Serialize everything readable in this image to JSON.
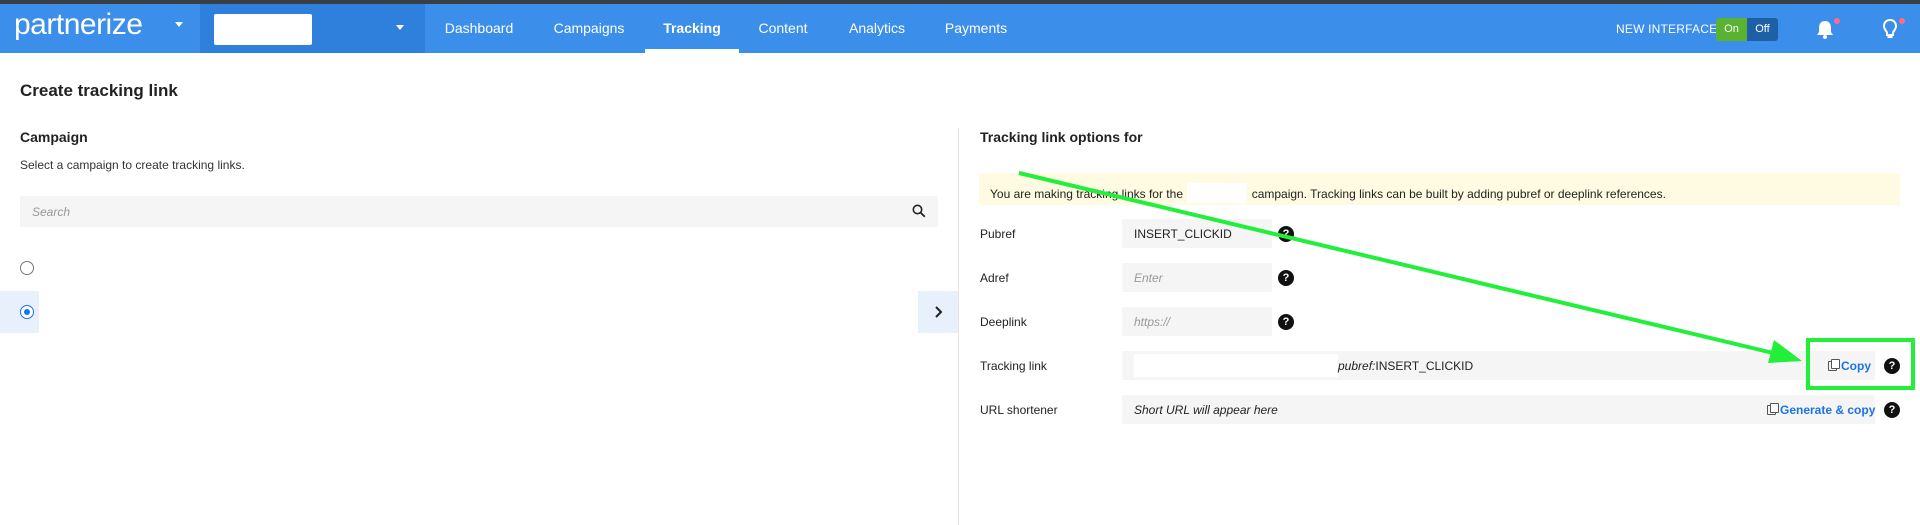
{
  "colors": {
    "nav_bg": "#3b8ee9",
    "accent": "#1a73e8",
    "toggle_on": "#5ab233",
    "annotation": "#22ef3a"
  },
  "navbar": {
    "logo": "partnerize",
    "tabs": [
      {
        "label": "Dashboard"
      },
      {
        "label": "Campaigns"
      },
      {
        "label": "Tracking"
      },
      {
        "label": "Content"
      },
      {
        "label": "Analytics"
      },
      {
        "label": "Payments"
      }
    ],
    "active_tab": "Tracking",
    "new_interface_label": "NEW INTERFACE",
    "toggle_on": "On",
    "toggle_off": "Off",
    "icons": [
      "bell-icon",
      "lightbulb-icon"
    ]
  },
  "page": {
    "title": "Create tracking link"
  },
  "campaign": {
    "title": "Campaign",
    "hint": "Select a campaign to create tracking links.",
    "search_placeholder": "Search"
  },
  "options": {
    "title": "Tracking link options for",
    "notice_before": "You are making tracking links for the",
    "notice_after": "campaign. Tracking links can be built by adding pubref or deeplink references.",
    "pubref_label": "Pubref",
    "pubref_value": "INSERT_CLICKID",
    "adref_label": "Adref",
    "adref_placeholder": "Enter",
    "deeplink_label": "Deeplink",
    "deeplink_placeholder": "https://",
    "tracking_link_label": "Tracking link",
    "tracking_link_prefix": "pubref:",
    "tracking_link_value": "INSERT_CLICKID",
    "copy_label": "Copy",
    "shortener_label": "URL shortener",
    "shortener_placeholder": "Short URL will appear here",
    "generate_label": "Generate & copy"
  }
}
